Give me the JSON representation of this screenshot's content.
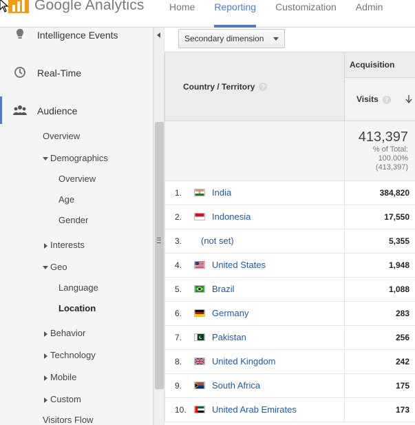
{
  "app": {
    "logo_text": "Google Analytics"
  },
  "nav": {
    "tabs": [
      "Home",
      "Reporting",
      "Customization",
      "Admin"
    ],
    "active": "Reporting"
  },
  "sidebar": {
    "main": [
      {
        "label": "Intelligence Events",
        "icon": "lightbulb-icon"
      },
      {
        "label": "Real-Time",
        "icon": "clock-icon"
      },
      {
        "label": "Audience",
        "icon": "people-icon"
      }
    ],
    "sub": {
      "overview": "Overview",
      "demographics": "Demographics",
      "demo_items": [
        "Overview",
        "Age",
        "Gender"
      ],
      "interests": "Interests",
      "geo": "Geo",
      "geo_items": [
        "Language",
        "Location"
      ],
      "behavior": "Behavior",
      "technology": "Technology",
      "mobile": "Mobile",
      "custom": "Custom",
      "visitors_flow": "Visitors Flow"
    }
  },
  "toolbar": {
    "secondary_dimension": "Secondary dimension"
  },
  "table": {
    "dimension_header": "Country / Territory",
    "group_header": "Acquisition",
    "metric_header": "Visits",
    "totals": {
      "value": "413,397",
      "pct_label": "% of Total:",
      "pct": "100.00%",
      "of": "(413,397)"
    },
    "rows": [
      {
        "rank": "1.",
        "country": "India",
        "value": "384,820",
        "flag": "india"
      },
      {
        "rank": "2.",
        "country": "Indonesia",
        "value": "17,550",
        "flag": "indonesia"
      },
      {
        "rank": "3.",
        "country": "(not set)",
        "value": "5,355",
        "flag": ""
      },
      {
        "rank": "4.",
        "country": "United States",
        "value": "1,948",
        "flag": "us"
      },
      {
        "rank": "5.",
        "country": "Brazil",
        "value": "1,088",
        "flag": "brazil"
      },
      {
        "rank": "6.",
        "country": "Germany",
        "value": "283",
        "flag": "germany"
      },
      {
        "rank": "7.",
        "country": "Pakistan",
        "value": "256",
        "flag": "pakistan"
      },
      {
        "rank": "8.",
        "country": "United Kingdom",
        "value": "242",
        "flag": "uk"
      },
      {
        "rank": "9.",
        "country": "South Africa",
        "value": "175",
        "flag": "south-africa"
      },
      {
        "rank": "10.",
        "country": "United Arab Emirates",
        "value": "173",
        "flag": "uae"
      }
    ]
  },
  "colors": {
    "accent": "#4f7cc9",
    "link": "#1e5aa8",
    "logo": "#f39c12"
  }
}
